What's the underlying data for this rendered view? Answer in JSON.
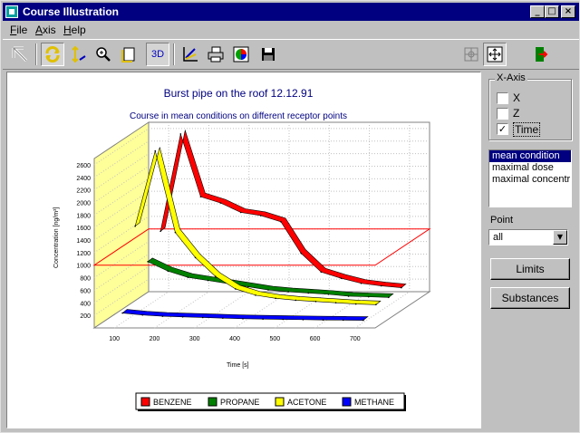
{
  "window": {
    "title": "Course Illustration",
    "controls": [
      "_",
      "□",
      "×"
    ]
  },
  "menu": {
    "items": [
      {
        "label": "File",
        "accel": "F",
        "rest": "ile"
      },
      {
        "label": "Axis",
        "accel": "A",
        "rest": "xis"
      },
      {
        "label": "Help",
        "accel": "H",
        "rest": "elp"
      }
    ]
  },
  "toolbar": {
    "buttons": [
      "pointer-arrow",
      "refresh",
      "vertical-scale",
      "zoom-in",
      "page-setup",
      "3d-view",
      "chart-settings",
      "print",
      "color-palette",
      "save",
      "grid-target",
      "move-view",
      "exit"
    ],
    "three_d_label": "3D"
  },
  "chart_data": {
    "type": "line",
    "style": "3d-ribbon",
    "title": "Burst pipe on the roof 12.12.91",
    "subtitle": "Course in mean conditions on different receptor points",
    "xlabel": "Time  [s]",
    "ylabel": "Concentration [ng/m³]",
    "x_ticks": [
      100,
      200,
      300,
      400,
      500,
      600,
      700
    ],
    "y_ticks": [
      200,
      400,
      600,
      800,
      1000,
      1200,
      1400,
      1600,
      1800,
      2000,
      2200,
      2400,
      2600
    ],
    "xlim": [
      50,
      750
    ],
    "ylim": [
      0,
      2700
    ],
    "threshold": 1000,
    "x": [
      100,
      150,
      200,
      250,
      300,
      350,
      400,
      450,
      500,
      550,
      600,
      650,
      700
    ],
    "series": [
      {
        "name": "BENZENE",
        "color": "#ff0000",
        "values": [
          1050,
          2600,
          1600,
          1500,
          1350,
          1300,
          1200,
          700,
          400,
          300,
          220,
          180,
          150
        ]
      },
      {
        "name": "PROPANE",
        "color": "#008000",
        "values": [
          700,
          550,
          450,
          400,
          350,
          300,
          250,
          220,
          200,
          180,
          150,
          140,
          130
        ]
      },
      {
        "name": "ACETONE",
        "color": "#ffff00",
        "values": [
          1400,
          2600,
          1300,
          900,
          600,
          400,
          300,
          250,
          220,
          200,
          180,
          160,
          150
        ]
      },
      {
        "name": "METHANE",
        "color": "#0000ff",
        "values": [
          150,
          120,
          100,
          90,
          80,
          70,
          60,
          55,
          50,
          45,
          40,
          38,
          35
        ]
      }
    ],
    "legend_position": "bottom"
  },
  "side": {
    "xaxis_title": "X-Axis",
    "xaxis_options": [
      {
        "label": "X",
        "checked": false
      },
      {
        "label": "Z",
        "checked": false
      },
      {
        "label": "Time",
        "checked": true
      }
    ],
    "condition_items": [
      "mean condition",
      "maximal dose",
      "maximal concentr"
    ],
    "condition_selected": "mean condition",
    "point_label": "Point",
    "point_value": "all",
    "limits_button": "Limits",
    "substances_button": "Substances"
  }
}
